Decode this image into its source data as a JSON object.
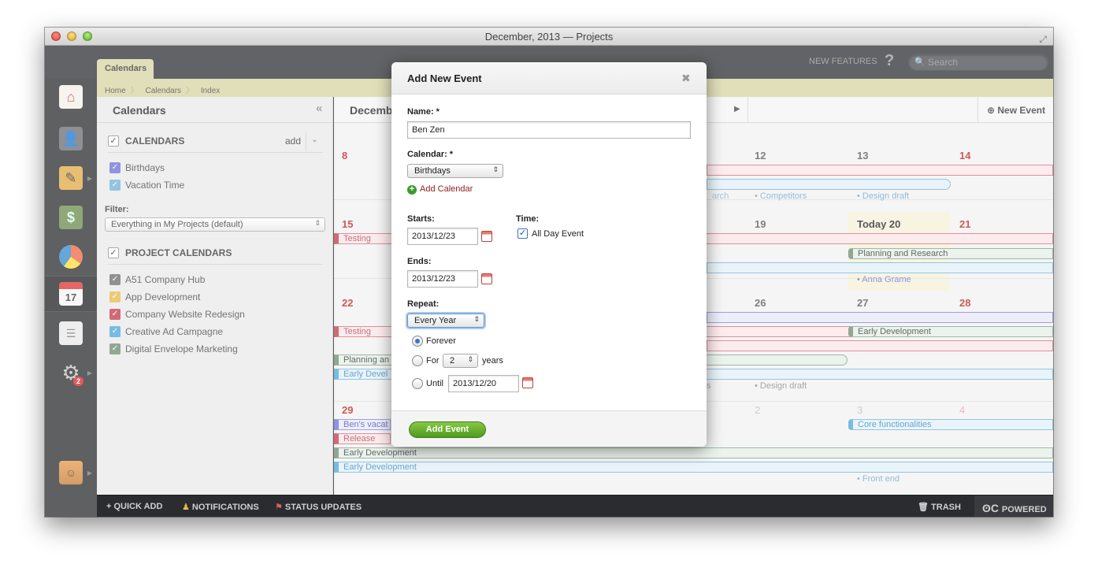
{
  "window": {
    "title": "December, 2013 — Projects"
  },
  "topbar": {
    "tab": "Calendars",
    "new_features": "NEW FEATURES",
    "help": "?",
    "search_placeholder": "Search"
  },
  "breadcrumb": [
    "Home",
    "Calendars",
    "Index"
  ],
  "sidebar_nav": [
    {
      "icon": "home-icon"
    },
    {
      "icon": "people-icon"
    },
    {
      "icon": "tools-icon"
    },
    {
      "icon": "money-icon"
    },
    {
      "icon": "pie-chart-icon"
    },
    {
      "icon": "calendar-icon",
      "label": "17"
    },
    {
      "icon": "notes-icon"
    },
    {
      "icon": "gear-icon",
      "badge": "2"
    },
    {
      "icon": "user-avatar"
    }
  ],
  "left_panel": {
    "title": "Calendars",
    "section1": {
      "label": "CALENDARS",
      "add": "add"
    },
    "calendars": [
      {
        "name": "Birthdays",
        "color": "#6b6fd6"
      },
      {
        "name": "Vacation Time",
        "color": "#6fb0d8"
      }
    ],
    "filter_label": "Filter:",
    "filter_value": "Everything in My Projects (default)",
    "section2": {
      "label": "PROJECT CALENDARS"
    },
    "project_calendars": [
      {
        "name": "A51 Company Hub",
        "color": "#6d6d6d"
      },
      {
        "name": "App Development",
        "color": "#e8b84a"
      },
      {
        "name": "Company Website Redesign",
        "color": "#c2384a"
      },
      {
        "name": "Creative Ad Campagne",
        "color": "#4aa6d8"
      },
      {
        "name": "Digital Envelope Marketing",
        "color": "#6d8a70"
      }
    ]
  },
  "calendar": {
    "month_label": "Decemb",
    "new_event": "New Event",
    "days": {
      "d8": "8",
      "d12": "12",
      "d13": "13",
      "d14": "14",
      "d15": "15",
      "d19": "19",
      "today": "Today 20",
      "d21": "21",
      "d22": "22",
      "d26": "26",
      "d27": "27",
      "d28": "28",
      "d29": "29",
      "n2": "2",
      "n3": "3",
      "n4": "4"
    },
    "events": {
      "competitors": "• Competitors",
      "design_draft": "• Design draft",
      "arch": "arch",
      "testing1": "Testing",
      "planning_research": "Planning and Research",
      "anna": "• Anna Grame",
      "testing2": "Testing",
      "early_dev1": "Early Development",
      "planning_an": "Planning an",
      "early_devel": "Early Devel",
      "s_frag": "s",
      "design_draft2": "• Design draft",
      "bens_vacat": "Ben's vacat",
      "release": "Release",
      "core": "Core functionalities",
      "early_dev2": "Early Development",
      "early_dev3": "Early Development",
      "front_end": "• Front end"
    }
  },
  "bottom_bar": {
    "quick_add": "QUICK ADD",
    "notifications": "NOTIFICATIONS",
    "status_updates": "STATUS UPDATES",
    "trash": "TRASH",
    "powered": "POWERED"
  },
  "modal": {
    "title": "Add New Event",
    "name_label": "Name: *",
    "name_value": "Ben Zen",
    "calendar_label": "Calendar: *",
    "calendar_value": "Birthdays",
    "add_calendar": "Add Calendar",
    "starts_label": "Starts:",
    "starts_value": "2013/12/23",
    "time_label": "Time:",
    "all_day": "All Day Event",
    "ends_label": "Ends:",
    "ends_value": "2013/12/23",
    "repeat_label": "Repeat:",
    "repeat_value": "Every Year",
    "forever": "Forever",
    "for_label": "For",
    "for_value": "2",
    "years": "years",
    "until_label": "Until",
    "until_value": "2013/12/20",
    "submit": "Add Event"
  }
}
